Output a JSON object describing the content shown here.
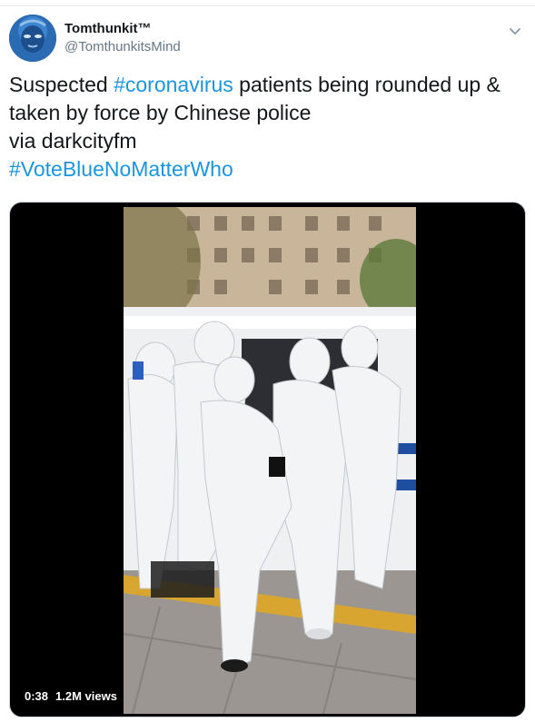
{
  "tweet": {
    "author": {
      "display_name": "Tomthunkit™",
      "handle": "@TomthunkitsMind"
    },
    "text": {
      "line1_pre": "Suspected ",
      "line1_hashtag": "#coronavirus",
      "line1_post": " patients being rounded up &",
      "line2": "taken by force by Chinese police",
      "line3": "via darkcityfm",
      "line4_hashtag": "#VoteBlueNoMatterWho"
    },
    "media": {
      "duration": "0:38",
      "views": "1.2M views"
    },
    "colors": {
      "link": "#1b95e0",
      "text": "#14171a",
      "secondary": "#657786"
    }
  }
}
